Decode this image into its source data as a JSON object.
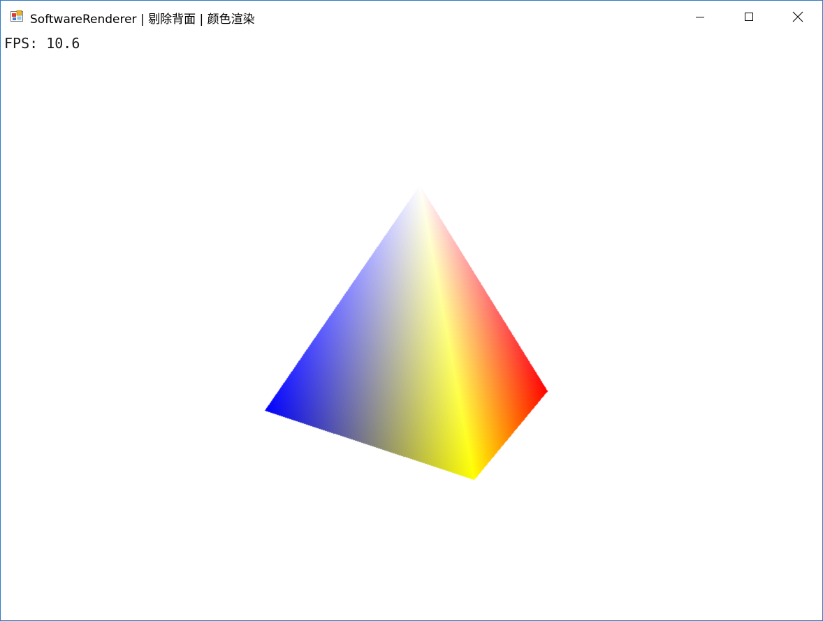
{
  "window": {
    "title": "SoftwareRenderer | 剔除背面 | 颜色渲染",
    "icon": "app-window-icon",
    "controls": {
      "minimize_icon": "minimize-icon",
      "maximize_icon": "maximize-icon",
      "close_icon": "close-icon"
    },
    "border_color": "#2b79c2"
  },
  "overlay": {
    "fps_text": "FPS: 10.6"
  },
  "scene": {
    "object": "tetrahedron",
    "vertex_colors": {
      "apex": "#ffffff",
      "left": "#0000ff",
      "right": "#ff0000",
      "bottom": "#ffff00"
    },
    "background": "#ffffff"
  }
}
